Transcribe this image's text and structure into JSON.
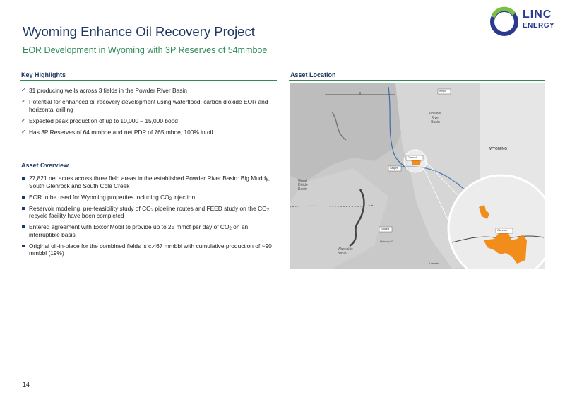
{
  "header": {
    "title": "Wyoming Enhance Oil Recovery Project",
    "subtitle": "EOR Development in Wyoming with 3P Reserves of 54mmboe",
    "logo_line1": "LINC",
    "logo_line2": "ENERGY"
  },
  "key_highlights": {
    "heading": "Key Highlights",
    "items": [
      "31 producing wells  across 3 fields in the Powder River Basin",
      "Potential for enhanced oil recovery development  using waterflood, carbon dioxide EOR and horizontal drilling",
      "Expected peak production of up to 10,000 – 15,000 bopd",
      "Has 3P Reserves of 64 mmboe and net PDP of 765 mboe, 100% in oil"
    ]
  },
  "asset_overview": {
    "heading": "Asset Overview",
    "item1": "27,821 net acres across three field areas in the established Powder River Basin: Big Muddy, South Glenrock and South Cole Creek",
    "item2_a": "EOR to be used for Wyoming properties including CO",
    "item2_sub": "2",
    "item2_b": " injection",
    "item3_a": "Reservoir modeling, pre-feasibility study of CO",
    "item3_sub1": "2",
    "item3_b": " pipeline routes and FEED study on the CO",
    "item3_sub2": "2",
    "item3_c": " recycle facility have been completed",
    "item4_a": "Entered agreement with ExxonMobil to provide up to 25 mmcf per day of CO",
    "item4_sub": "2",
    "item4_b": " on an interruptible basis",
    "item5": "Original oil-in-place for the combined fields is c.467 mmbbl with cumulative production of  ~90 mmbbl (19%)"
  },
  "asset_location": {
    "heading": "Asset Location",
    "map_labels": {
      "powder_river": "Powder\nRiver\nBasin",
      "wyoming": "WYOMING",
      "great_divide": "Great\nDivide\nBasin",
      "washakie": "Washakie\nBasin",
      "casper": "Casper",
      "glenrock": "Glenrock",
      "rawlins": "Rawlins",
      "laramie": "Laramie",
      "wright": "Wright",
      "highway": "Highway 80"
    }
  },
  "footer": {
    "page_number": "14"
  },
  "colors": {
    "title": "#1f3864",
    "accent_green": "#2e8b57",
    "acreage": "#f28c1a"
  }
}
